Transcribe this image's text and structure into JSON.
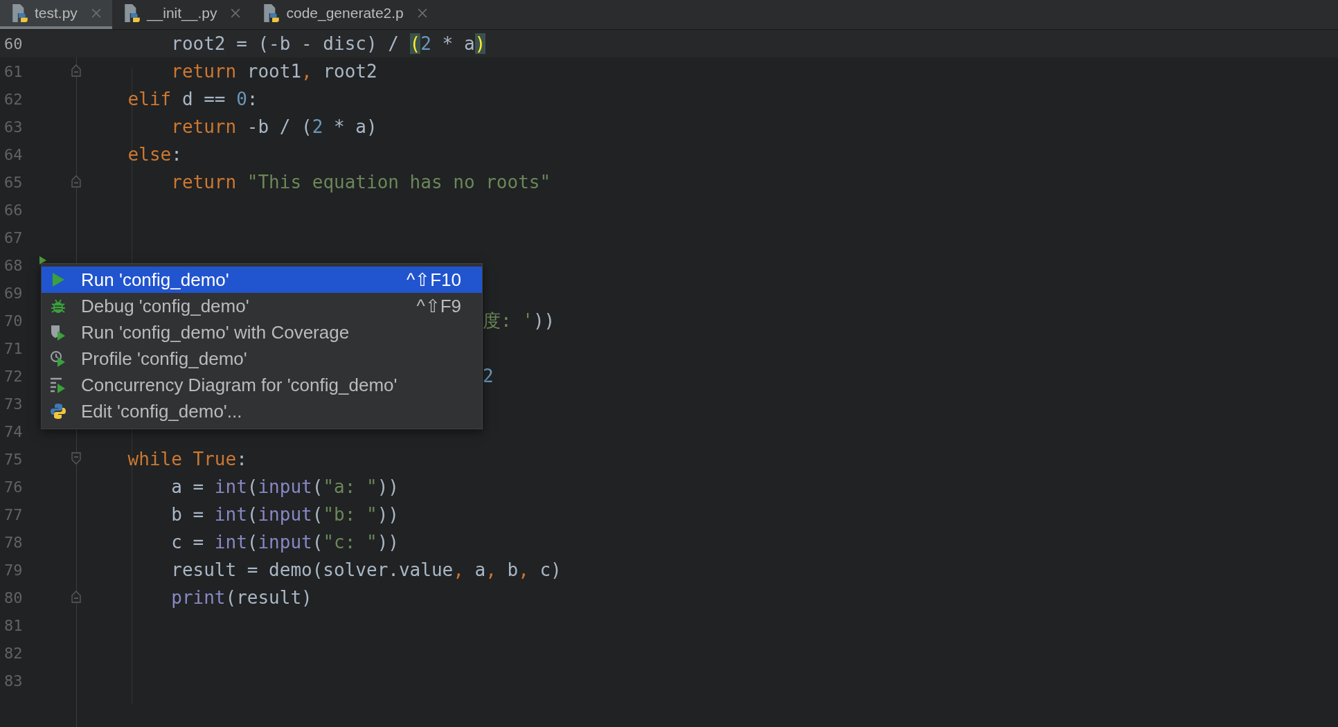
{
  "tabs": [
    {
      "label": "test.py",
      "selected": true
    },
    {
      "label": "__init__.py",
      "selected": false
    },
    {
      "label": "code_generate2.p",
      "selected": false
    }
  ],
  "editor": {
    "lines": [
      {
        "number": "60",
        "current": true,
        "fold_start": false,
        "fold_end": false,
        "run_marker": false,
        "covered": false,
        "tokens": [
          {
            "text": "        root2 = (-b - disc) / ",
            "kind": "plain"
          },
          {
            "text": "(",
            "kind": "brace_match"
          },
          {
            "text": "2",
            "kind": "number"
          },
          {
            "text": " * a",
            "kind": "plain"
          },
          {
            "text": ")",
            "kind": "brace_match"
          }
        ]
      },
      {
        "number": "61",
        "current": false,
        "fold_start": false,
        "fold_end": true,
        "run_marker": false,
        "covered": false,
        "tokens": [
          {
            "text": "        return",
            "kind": "keyword"
          },
          {
            "text": " root1",
            "kind": "plain"
          },
          {
            "text": ",",
            "kind": "keyword"
          },
          {
            "text": " root2",
            "kind": "plain"
          }
        ]
      },
      {
        "number": "62",
        "current": false,
        "fold_start": false,
        "fold_end": false,
        "run_marker": false,
        "covered": false,
        "tokens": [
          {
            "text": "    elif",
            "kind": "keyword"
          },
          {
            "text": " d == ",
            "kind": "plain"
          },
          {
            "text": "0",
            "kind": "number"
          },
          {
            "text": ":",
            "kind": "plain"
          }
        ]
      },
      {
        "number": "63",
        "current": false,
        "fold_start": false,
        "fold_end": false,
        "run_marker": false,
        "covered": false,
        "tokens": [
          {
            "text": "        return",
            "kind": "keyword"
          },
          {
            "text": " -b / (",
            "kind": "plain"
          },
          {
            "text": "2",
            "kind": "number"
          },
          {
            "text": " * a)",
            "kind": "plain"
          }
        ]
      },
      {
        "number": "64",
        "current": false,
        "fold_start": false,
        "fold_end": false,
        "run_marker": false,
        "covered": false,
        "tokens": [
          {
            "text": "    else",
            "kind": "keyword"
          },
          {
            "text": ":",
            "kind": "plain"
          }
        ]
      },
      {
        "number": "65",
        "current": false,
        "fold_start": false,
        "fold_end": true,
        "run_marker": false,
        "covered": false,
        "tokens": [
          {
            "text": "        return",
            "kind": "keyword"
          },
          {
            "text": " \"This equation has no roots\"",
            "kind": "string"
          }
        ]
      },
      {
        "number": "66",
        "current": false,
        "fold_start": false,
        "fold_end": false,
        "run_marker": false
      },
      {
        "number": "67",
        "current": false,
        "fold_start": false,
        "fold_end": false,
        "run_marker": false
      },
      {
        "number": "68",
        "current": false,
        "fold_start": false,
        "fold_end": false,
        "run_marker": true
      },
      {
        "number": "69",
        "current": false,
        "fold_start": false,
        "fold_end": false,
        "run_marker": false
      },
      {
        "number": "70",
        "current": false,
        "fold_start": false,
        "fold_end": false,
        "run_marker": false,
        "covered": true,
        "tokens": [
          {
            "text": "度: '",
            "kind": "string"
          },
          {
            "text": "))",
            "kind": "plain"
          }
        ]
      },
      {
        "number": "71",
        "current": false,
        "fold_start": false,
        "fold_end": false,
        "run_marker": false
      },
      {
        "number": "72",
        "current": false,
        "fold_start": false,
        "fold_end": false,
        "run_marker": false,
        "covered": true,
        "tokens": [
          {
            "text": "2",
            "kind": "number"
          }
        ]
      },
      {
        "number": "73",
        "current": false,
        "fold_start": false,
        "fold_end": false,
        "run_marker": false
      },
      {
        "number": "74",
        "current": false,
        "fold_start": false,
        "fold_end": false,
        "run_marker": false
      },
      {
        "number": "75",
        "current": false,
        "fold_start": true,
        "fold_end": false,
        "run_marker": false,
        "covered": false,
        "tokens": [
          {
            "text": "    while",
            "kind": "keyword"
          },
          {
            "text": " True",
            "kind": "keyword"
          },
          {
            "text": ":",
            "kind": "plain"
          }
        ]
      },
      {
        "number": "76",
        "current": false,
        "fold_start": false,
        "fold_end": false,
        "run_marker": false,
        "covered": false,
        "tokens": [
          {
            "text": "        a = ",
            "kind": "plain"
          },
          {
            "text": "int",
            "kind": "builtin"
          },
          {
            "text": "(",
            "kind": "plain"
          },
          {
            "text": "input",
            "kind": "builtin"
          },
          {
            "text": "(",
            "kind": "plain"
          },
          {
            "text": "\"a: \"",
            "kind": "string"
          },
          {
            "text": "))",
            "kind": "plain"
          }
        ]
      },
      {
        "number": "77",
        "current": false,
        "fold_start": false,
        "fold_end": false,
        "run_marker": false,
        "covered": false,
        "tokens": [
          {
            "text": "        b = ",
            "kind": "plain"
          },
          {
            "text": "int",
            "kind": "builtin"
          },
          {
            "text": "(",
            "kind": "plain"
          },
          {
            "text": "input",
            "kind": "builtin"
          },
          {
            "text": "(",
            "kind": "plain"
          },
          {
            "text": "\"b: \"",
            "kind": "string"
          },
          {
            "text": "))",
            "kind": "plain"
          }
        ]
      },
      {
        "number": "78",
        "current": false,
        "fold_start": false,
        "fold_end": false,
        "run_marker": false,
        "covered": false,
        "tokens": [
          {
            "text": "        c = ",
            "kind": "plain"
          },
          {
            "text": "int",
            "kind": "builtin"
          },
          {
            "text": "(",
            "kind": "plain"
          },
          {
            "text": "input",
            "kind": "builtin"
          },
          {
            "text": "(",
            "kind": "plain"
          },
          {
            "text": "\"c: \"",
            "kind": "string"
          },
          {
            "text": "))",
            "kind": "plain"
          }
        ]
      },
      {
        "number": "79",
        "current": false,
        "fold_start": false,
        "fold_end": false,
        "run_marker": false,
        "covered": false,
        "tokens": [
          {
            "text": "        result = demo(solver.value",
            "kind": "plain"
          },
          {
            "text": ",",
            "kind": "keyword"
          },
          {
            "text": " a",
            "kind": "plain"
          },
          {
            "text": ",",
            "kind": "keyword"
          },
          {
            "text": " b",
            "kind": "plain"
          },
          {
            "text": ",",
            "kind": "keyword"
          },
          {
            "text": " c)",
            "kind": "plain"
          }
        ]
      },
      {
        "number": "80",
        "current": false,
        "fold_start": false,
        "fold_end": true,
        "run_marker": false,
        "covered": false,
        "tokens": [
          {
            "text": "        print",
            "kind": "builtin"
          },
          {
            "text": "(result)",
            "kind": "plain"
          }
        ]
      },
      {
        "number": "81",
        "current": false,
        "fold_start": false,
        "fold_end": false,
        "run_marker": false
      },
      {
        "number": "82",
        "current": false,
        "fold_start": false,
        "fold_end": false,
        "run_marker": false
      },
      {
        "number": "83",
        "current": false,
        "fold_start": false,
        "fold_end": false,
        "run_marker": false
      }
    ]
  },
  "run_menu": {
    "items": [
      {
        "kind": "run",
        "label": "Run 'config_demo'",
        "shortcut": "^⇧F10",
        "selected": true
      },
      {
        "kind": "debug",
        "label": "Debug 'config_demo'",
        "shortcut": "^⇧F9",
        "selected": false
      },
      {
        "kind": "coverage",
        "label": "Run 'config_demo' with Coverage",
        "selected": false
      },
      {
        "kind": "profile",
        "label": "Profile 'config_demo'",
        "selected": false
      },
      {
        "kind": "concurrency",
        "label": "Concurrency Diagram for 'config_demo'",
        "selected": false
      },
      {
        "kind": "python",
        "label": "Edit 'config_demo'...",
        "selected": false
      }
    ]
  }
}
